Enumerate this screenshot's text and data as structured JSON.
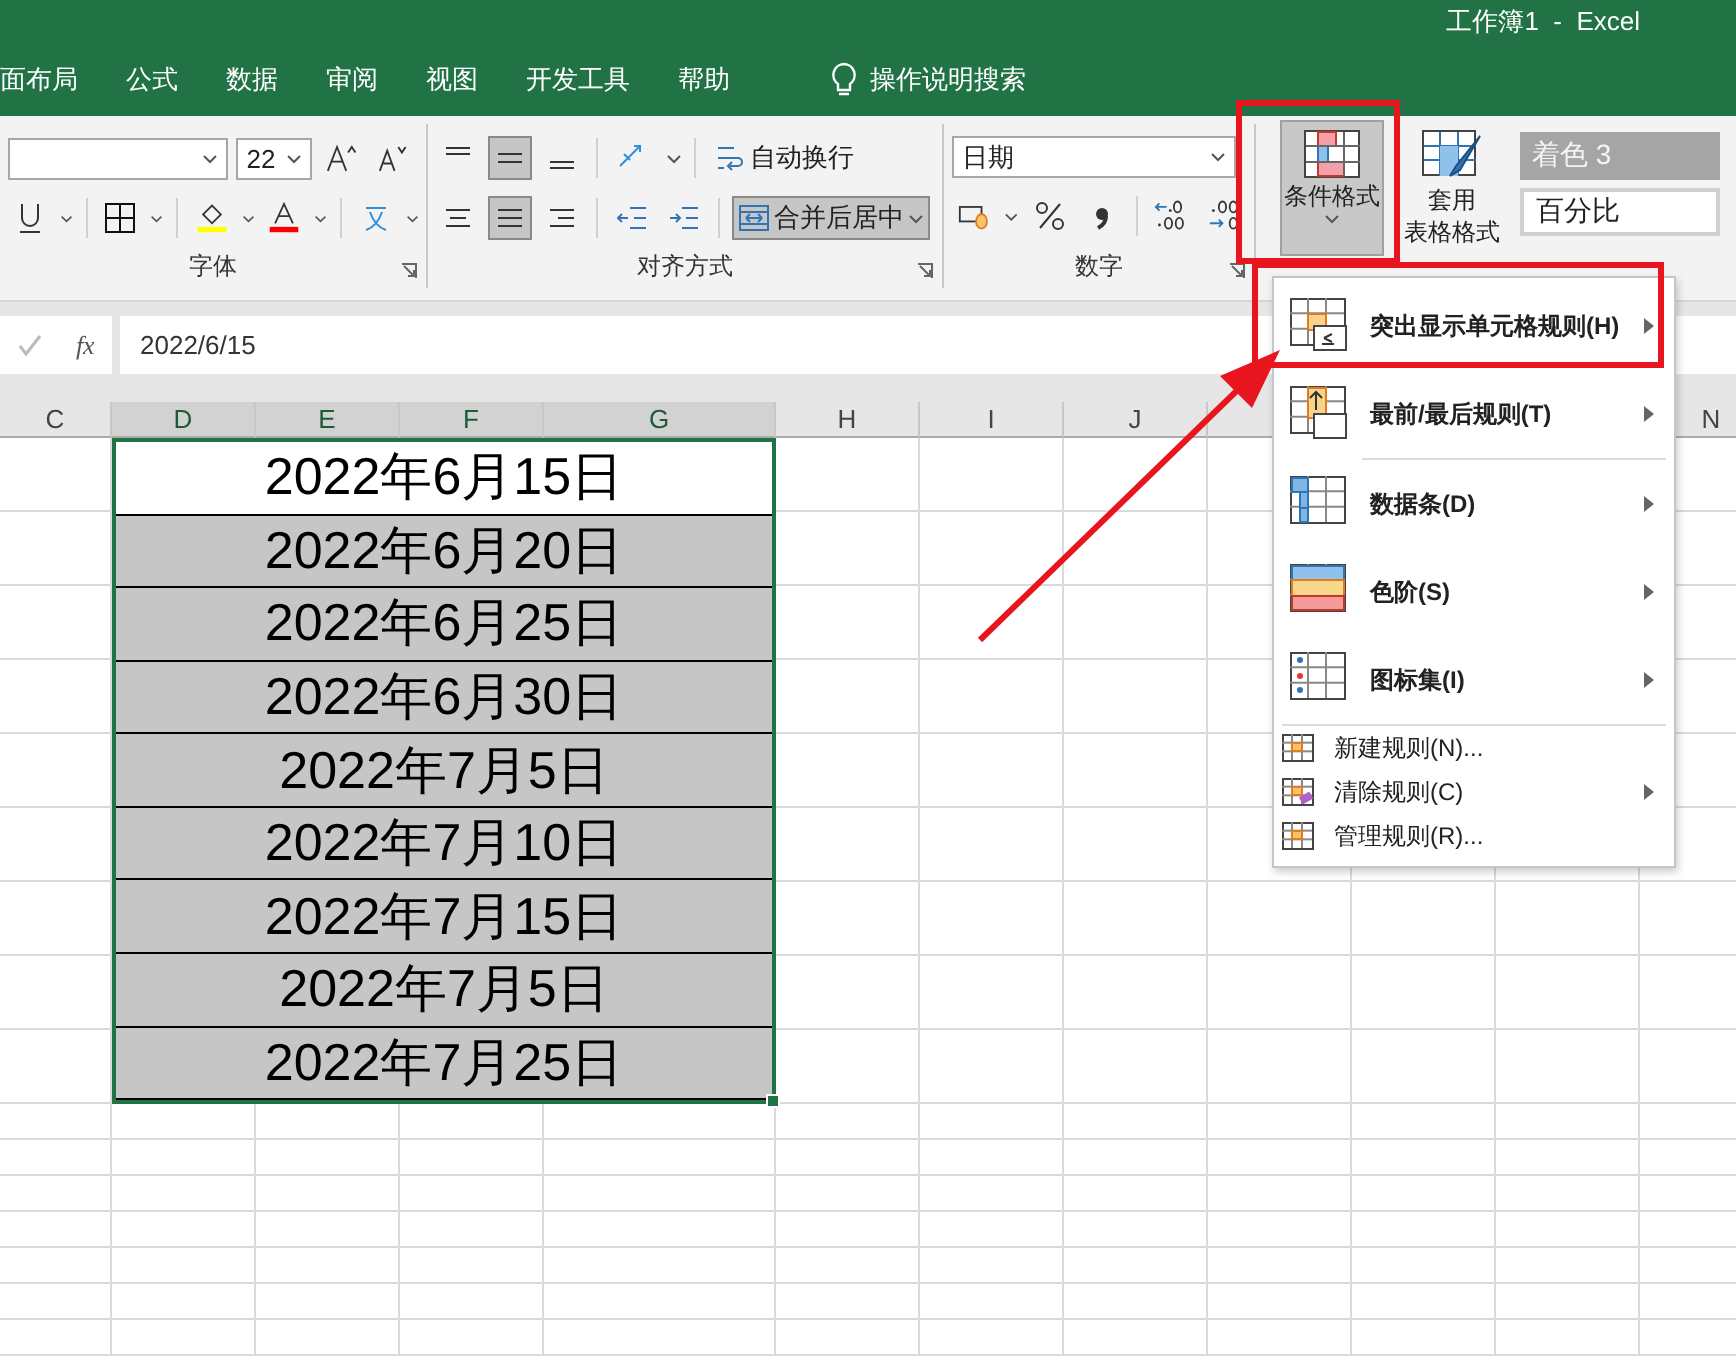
{
  "window": {
    "title": "工作簿1  -  Excel"
  },
  "ribbon_tabs": [
    {
      "label": "面布局"
    },
    {
      "label": "公式"
    },
    {
      "label": "数据"
    },
    {
      "label": "审阅"
    },
    {
      "label": "视图"
    },
    {
      "label": "开发工具"
    },
    {
      "label": "帮助"
    }
  ],
  "tell_me": {
    "label": "操作说明搜索"
  },
  "font_group": {
    "label": "字体",
    "font_size": "22"
  },
  "alignment_group": {
    "label": "对齐方式",
    "vertical_align": [
      {
        "selected": false
      },
      {
        "selected": true
      },
      {
        "selected": false
      }
    ],
    "horizontal_align": [
      {
        "selected": false
      },
      {
        "selected": true
      },
      {
        "selected": false
      }
    ],
    "wrap_text": "自动换行",
    "merge_center": {
      "label": "合并后居中",
      "selected": true
    }
  },
  "number_group": {
    "label": "数字",
    "format": "日期"
  },
  "styles_group": {
    "conditional_format": {
      "label": "条件格式",
      "selected": true
    },
    "format_as_table": {
      "label_1": "套用",
      "label_2": "表格格式"
    },
    "cell_styles": [
      {
        "label": "着色 3",
        "kind": "accent"
      },
      {
        "label": "百分比",
        "kind": "plain"
      }
    ]
  },
  "formula_bar": {
    "fx": "fx",
    "value": "2022/6/15"
  },
  "columns": [
    {
      "label": "C",
      "selected": false
    },
    {
      "label": "D",
      "selected": true
    },
    {
      "label": "E",
      "selected": true
    },
    {
      "label": "F",
      "selected": true
    },
    {
      "label": "G",
      "selected": true
    },
    {
      "label": "H",
      "selected": false
    },
    {
      "label": "I",
      "selected": false
    },
    {
      "label": "J",
      "selected": false
    }
  ],
  "trailing_column": {
    "label": "N",
    "selected": false
  },
  "cells": [
    {
      "value": "2022年6月15日",
      "active": true
    },
    {
      "value": "2022年6月20日",
      "active": false
    },
    {
      "value": "2022年6月25日",
      "active": false
    },
    {
      "value": "2022年6月30日",
      "active": false
    },
    {
      "value": "2022年7月5日",
      "active": false
    },
    {
      "value": "2022年7月10日",
      "active": false
    },
    {
      "value": "2022年7月15日",
      "active": false
    },
    {
      "value": "2022年7月5日",
      "active": false
    },
    {
      "value": "2022年7月25日",
      "active": false
    }
  ],
  "menu": {
    "items": [
      {
        "label": "突出显示单元格规则(H)",
        "kind": "large",
        "submenu": true,
        "separator_after": false
      },
      {
        "label": "最前/最后规则(T)",
        "kind": "large",
        "submenu": true,
        "separator_after": true
      },
      {
        "label": "数据条(D)",
        "kind": "large",
        "submenu": true,
        "separator_after": false
      },
      {
        "label": "色阶(S)",
        "kind": "large",
        "submenu": true,
        "separator_after": false
      },
      {
        "label": "图标集(I)",
        "kind": "large",
        "submenu": true,
        "separator_after": true
      },
      {
        "label": "新建规则(N)...",
        "kind": "small",
        "submenu": false,
        "separator_after": false
      },
      {
        "label": "清除规则(C)",
        "kind": "small",
        "submenu": true,
        "separator_after": false
      },
      {
        "label": "管理规则(R)...",
        "kind": "small",
        "submenu": false,
        "separator_after": false
      }
    ]
  }
}
